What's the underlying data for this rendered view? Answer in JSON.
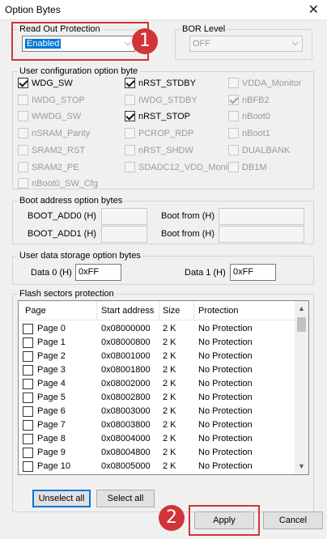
{
  "window": {
    "title": "Option Bytes",
    "close_glyph": "✕"
  },
  "read_out": {
    "label": "Read Out Protection",
    "value": "Enabled"
  },
  "bor": {
    "label": "BOR Level",
    "value": "OFF"
  },
  "user_config": {
    "label": "User configuration option byte",
    "options": [
      {
        "label": "WDG_SW",
        "checked": true,
        "enabled": true
      },
      {
        "label": "nRST_STDBY",
        "checked": true,
        "enabled": true
      },
      {
        "label": "VDDA_Monitor",
        "checked": false,
        "enabled": false
      },
      {
        "label": "IWDG_STOP",
        "checked": false,
        "enabled": false
      },
      {
        "label": "IWDG_STDBY",
        "checked": false,
        "enabled": false
      },
      {
        "label": "nBFB2",
        "checked": true,
        "enabled": false
      },
      {
        "label": "WWDG_SW",
        "checked": false,
        "enabled": false
      },
      {
        "label": "nRST_STOP",
        "checked": true,
        "enabled": true
      },
      {
        "label": "nBoot0",
        "checked": false,
        "enabled": false
      },
      {
        "label": "nSRAM_Parity",
        "checked": false,
        "enabled": false
      },
      {
        "label": "PCROP_RDP",
        "checked": false,
        "enabled": false
      },
      {
        "label": "nBoot1",
        "checked": false,
        "enabled": false
      },
      {
        "label": "SRAM2_RST",
        "checked": false,
        "enabled": false
      },
      {
        "label": "nRST_SHDW",
        "checked": false,
        "enabled": false
      },
      {
        "label": "DUALBANK",
        "checked": false,
        "enabled": false
      },
      {
        "label": "SRAM2_PE",
        "checked": false,
        "enabled": false
      },
      {
        "label": "SDADC12_VDD_Monitor",
        "checked": false,
        "enabled": false
      },
      {
        "label": "DB1M",
        "checked": false,
        "enabled": false
      },
      {
        "label": "nBoot0_SW_Cfg",
        "checked": false,
        "enabled": false
      }
    ]
  },
  "boot": {
    "label": "Boot address option bytes",
    "add0": "BOOT_ADD0 (H)",
    "add1": "BOOT_ADD1 (H)",
    "from": "Boot from (H)"
  },
  "user_data": {
    "label": "User data storage option bytes",
    "data0_label": "Data 0 (H)",
    "data0_value": "0xFF",
    "data1_label": "Data 1 (H)",
    "data1_value": "0xFF"
  },
  "flash": {
    "label": "Flash sectors protection",
    "columns": [
      "Page",
      "Start address",
      "Size",
      "No Protection"
    ],
    "header_protection": "Protection",
    "rows": [
      [
        "Page 0",
        "0x08000000",
        "2 K",
        "No Protection"
      ],
      [
        "Page 1",
        "0x08000800",
        "2 K",
        "No Protection"
      ],
      [
        "Page 2",
        "0x08001000",
        "2 K",
        "No Protection"
      ],
      [
        "Page 3",
        "0x08001800",
        "2 K",
        "No Protection"
      ],
      [
        "Page 4",
        "0x08002000",
        "2 K",
        "No Protection"
      ],
      [
        "Page 5",
        "0x08002800",
        "2 K",
        "No Protection"
      ],
      [
        "Page 6",
        "0x08003000",
        "2 K",
        "No Protection"
      ],
      [
        "Page 7",
        "0x08003800",
        "2 K",
        "No Protection"
      ],
      [
        "Page 8",
        "0x08004000",
        "2 K",
        "No Protection"
      ],
      [
        "Page 9",
        "0x08004800",
        "2 K",
        "No Protection"
      ],
      [
        "Page 10",
        "0x08005000",
        "2 K",
        "No Protection"
      ]
    ]
  },
  "buttons": {
    "unselect_all": "Unselect all",
    "select_all": "Select all",
    "apply": "Apply",
    "cancel": "Cancel"
  },
  "annotations": {
    "one": "1",
    "two": "2"
  },
  "colors": {
    "accent": "#0078d7",
    "annotation_red": "#d13438"
  }
}
